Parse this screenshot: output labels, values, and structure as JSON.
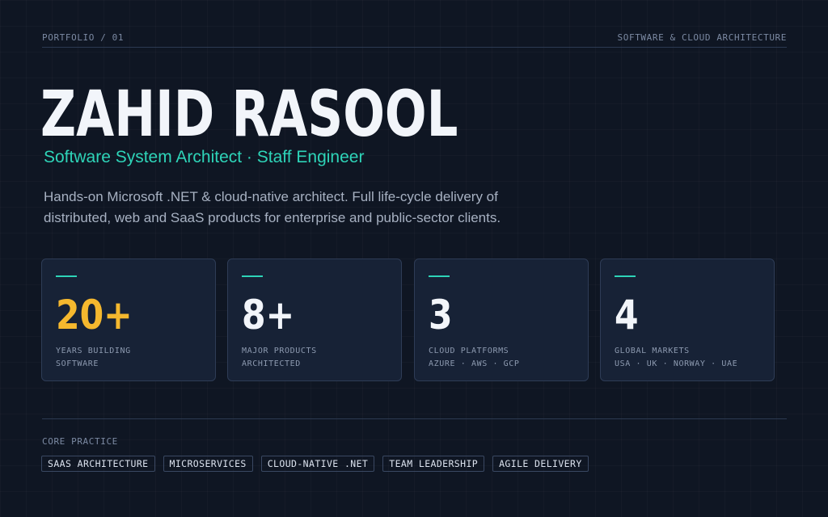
{
  "header": {
    "left": "PORTFOLIO / 01",
    "right": "SOFTWARE & CLOUD ARCHITECTURE"
  },
  "hero": {
    "name": "ZAHID RASOOL",
    "role": "Software System Architect · Staff Engineer",
    "summary_line1": "Hands-on Microsoft .NET & cloud-native architect. Full life-cycle delivery of",
    "summary_line2": "distributed, web and SaaS products for enterprise and public-sector clients."
  },
  "stats": [
    {
      "value": "20+",
      "line1": "YEARS BUILDING",
      "line2": "SOFTWARE",
      "color": "#f5b82e"
    },
    {
      "value": "8+",
      "line1": "MAJOR PRODUCTS",
      "line2": "ARCHITECTED",
      "color": "#f2f5fa"
    },
    {
      "value": "3",
      "line1": "CLOUD PLATFORMS",
      "line2": "AZURE · AWS · GCP",
      "color": "#f2f5fa"
    },
    {
      "value": "4",
      "line1": "GLOBAL MARKETS",
      "line2": "USA · UK · NORWAY · UAE",
      "color": "#f2f5fa"
    }
  ],
  "core": {
    "label": "CORE PRACTICE",
    "tags": [
      "SAAS ARCHITECTURE",
      "MICROSERVICES",
      "CLOUD-NATIVE .NET",
      "TEAM LEADERSHIP",
      "AGILE DELIVERY"
    ]
  },
  "colors": {
    "background": "#0f1623",
    "accent": "#2ed4b8",
    "highlight": "#f5b82e"
  }
}
